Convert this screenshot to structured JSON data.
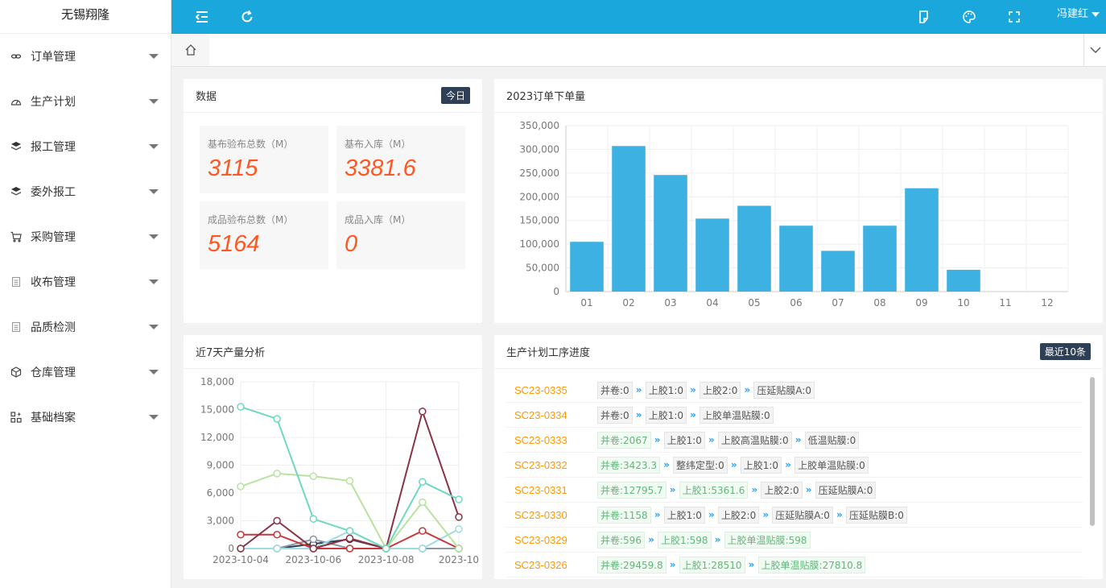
{
  "app": {
    "brand": "无锡翔隆",
    "user": "冯建红"
  },
  "sidebar": {
    "items": [
      {
        "label": "订单管理",
        "icon": "link-icon"
      },
      {
        "label": "生产计划",
        "icon": "dashboard-icon"
      },
      {
        "label": "报工管理",
        "icon": "layers-icon"
      },
      {
        "label": "委外报工",
        "icon": "layers-icon"
      },
      {
        "label": "采购管理",
        "icon": "cart-icon"
      },
      {
        "label": "收布管理",
        "icon": "document-icon"
      },
      {
        "label": "品质检测",
        "icon": "document-icon"
      },
      {
        "label": "仓库管理",
        "icon": "box-icon"
      },
      {
        "label": "基础档案",
        "icon": "apps-icon"
      }
    ]
  },
  "topbar": {
    "icons": [
      "menu-fold-icon",
      "refresh-icon",
      "note-icon",
      "palette-icon",
      "fullscreen-icon"
    ]
  },
  "stats": {
    "title": "数据",
    "badge": "今日",
    "items": [
      {
        "label": "基布验布总数（M）",
        "value": "3115"
      },
      {
        "label": "基布入库（M）",
        "value": "3381.6"
      },
      {
        "label": "成品验布总数（M）",
        "value": "5164"
      },
      {
        "label": "成品入库（M）",
        "value": "0"
      }
    ]
  },
  "orders_card": {
    "title": "2023订单下单量"
  },
  "trend_card": {
    "title": "近7天产量分析"
  },
  "progress_card": {
    "title": "生产计划工序进度",
    "badge": "最近10条",
    "rows": [
      {
        "code": "SC23-0335",
        "steps": [
          {
            "t": "并卷:0",
            "done": false
          },
          {
            "t": "上胶1:0",
            "done": false
          },
          {
            "t": "上胶2:0",
            "done": false
          },
          {
            "t": "压延贴膜A:0",
            "done": false
          }
        ]
      },
      {
        "code": "SC23-0334",
        "steps": [
          {
            "t": "并卷:0",
            "done": false
          },
          {
            "t": "上胶1:0",
            "done": false
          },
          {
            "t": "上胶单温贴膜:0",
            "done": false
          }
        ]
      },
      {
        "code": "SC23-0333",
        "steps": [
          {
            "t": "并卷:2067",
            "done": true
          },
          {
            "t": "上胶1:0",
            "done": false
          },
          {
            "t": "上胶高温贴膜:0",
            "done": false
          },
          {
            "t": "低温贴膜:0",
            "done": false
          }
        ]
      },
      {
        "code": "SC23-0332",
        "steps": [
          {
            "t": "并卷:3423.3",
            "done": true
          },
          {
            "t": "整纬定型:0",
            "done": false
          },
          {
            "t": "上胶1:0",
            "done": false
          },
          {
            "t": "上胶单温贴膜:0",
            "done": false
          }
        ]
      },
      {
        "code": "SC23-0331",
        "steps": [
          {
            "t": "并卷:12795.7",
            "done": true
          },
          {
            "t": "上胶1:5361.6",
            "done": true
          },
          {
            "t": "上胶2:0",
            "done": false
          },
          {
            "t": "压延贴膜A:0",
            "done": false
          }
        ]
      },
      {
        "code": "SC23-0330",
        "steps": [
          {
            "t": "并卷:1158",
            "done": true
          },
          {
            "t": "上胶1:0",
            "done": false
          },
          {
            "t": "上胶2:0",
            "done": false
          },
          {
            "t": "压延贴膜A:0",
            "done": false
          },
          {
            "t": "压延贴膜B:0",
            "done": false
          }
        ]
      },
      {
        "code": "SC23-0329",
        "steps": [
          {
            "t": "并卷:596",
            "done": true
          },
          {
            "t": "上胶1:598",
            "done": true
          },
          {
            "t": "上胶单温贴膜:598",
            "done": true
          }
        ]
      },
      {
        "code": "SC23-0326",
        "steps": [
          {
            "t": "并卷:29459.8",
            "done": true
          },
          {
            "t": "上胶1:28510",
            "done": true
          },
          {
            "t": "上胶单温贴膜:27810.8",
            "done": true
          }
        ]
      }
    ]
  },
  "chart_data": [
    {
      "type": "bar",
      "title": "2023订单下单量",
      "categories": [
        "01",
        "02",
        "03",
        "04",
        "05",
        "06",
        "07",
        "08",
        "09",
        "10",
        "11",
        "12"
      ],
      "values": [
        105000,
        307000,
        246000,
        154000,
        181000,
        139000,
        86000,
        139000,
        218000,
        46000,
        0,
        0
      ],
      "ylim": [
        0,
        350000
      ],
      "yticks": [
        "0",
        "50,000",
        "100,000",
        "150,000",
        "200,000",
        "250,000",
        "300,000",
        "350,000"
      ],
      "grid": true,
      "color": "#3eb1e3"
    },
    {
      "type": "line",
      "title": "近7天产量分析",
      "x_ticks": [
        "2023-10-04",
        "2023-10-06",
        "2023-10-08",
        "2023-10"
      ],
      "ylim": [
        0,
        18000
      ],
      "yticks": [
        "0",
        "3,000",
        "6,000",
        "9,000",
        "12,000",
        "15,000",
        "18,000"
      ],
      "grid": true,
      "series": [
        {
          "color": "#6fd8bf",
          "values": [
            15300,
            14000,
            3200,
            1900,
            0,
            7200,
            5300
          ]
        },
        {
          "color": "#b7e39e",
          "values": [
            6700,
            8100,
            7800,
            7300,
            0,
            5000,
            0
          ]
        },
        {
          "color": "#8a3246",
          "values": [
            0,
            3000,
            0,
            1100,
            0,
            14800,
            3400
          ]
        },
        {
          "color": "#c8373a",
          "values": [
            1500,
            1500,
            0,
            0,
            0,
            1900,
            0
          ]
        },
        {
          "color": "#9fdbe6",
          "values": [
            0,
            0,
            0,
            1900,
            0,
            0,
            2100
          ]
        },
        {
          "color": "#8898aa",
          "values": [
            0,
            0,
            1000,
            0,
            0,
            0,
            0
          ]
        },
        {
          "color": "#2f3c4c",
          "values": [
            0,
            0,
            500,
            1000,
            0,
            0,
            0
          ]
        }
      ]
    }
  ]
}
